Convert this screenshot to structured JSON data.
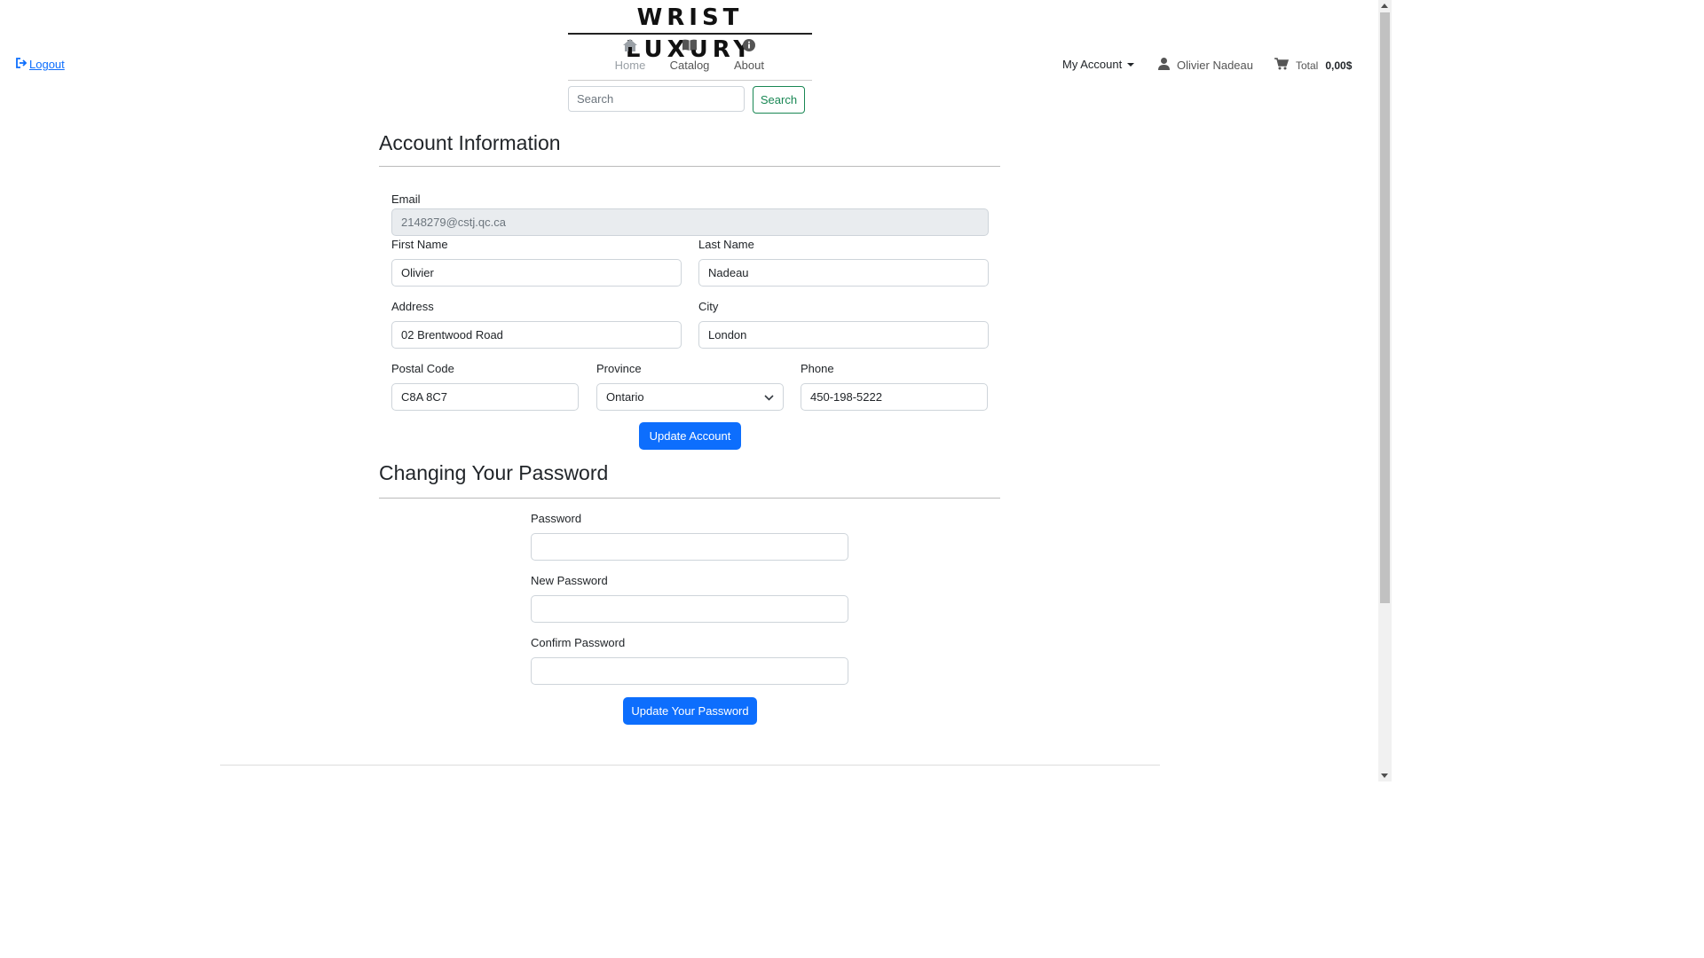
{
  "header": {
    "logo": "WRIST LUXURY",
    "nav": [
      {
        "label": "Home",
        "icon": "home-icon"
      },
      {
        "label": "Catalog",
        "icon": "book-icon"
      },
      {
        "label": "About",
        "icon": "info-icon"
      }
    ],
    "logout_label": "Logout",
    "search": {
      "placeholder": "Search",
      "button_label": "Search"
    },
    "my_account_label": "My Account",
    "user_name": "Olivier Nadeau",
    "cart": {
      "label": "Total",
      "amount": "0,00$"
    }
  },
  "account": {
    "title": "Account Information",
    "email": {
      "label": "Email",
      "value": "2148279@cstj.qc.ca"
    },
    "first_name": {
      "label": "First Name",
      "value": "Olivier"
    },
    "last_name": {
      "label": "Last Name",
      "value": "Nadeau"
    },
    "address": {
      "label": "Address",
      "value": "02 Brentwood Road"
    },
    "city": {
      "label": "City",
      "value": "London"
    },
    "postal_code": {
      "label": "Postal Code",
      "value": "C8A 8C7"
    },
    "province": {
      "label": "Province",
      "value": "Ontario"
    },
    "phone": {
      "label": "Phone",
      "value": "450-198-5222"
    },
    "submit_label": "Update Account"
  },
  "password": {
    "title": "Changing Your Password",
    "current": {
      "label": "Password",
      "value": ""
    },
    "new": {
      "label": "New Password",
      "value": ""
    },
    "confirm": {
      "label": "Confirm Password",
      "value": ""
    },
    "submit_label": "Update Your Password"
  },
  "colors": {
    "primary": "#0d6efd",
    "success": "#198754",
    "link": "#0d6efd"
  }
}
